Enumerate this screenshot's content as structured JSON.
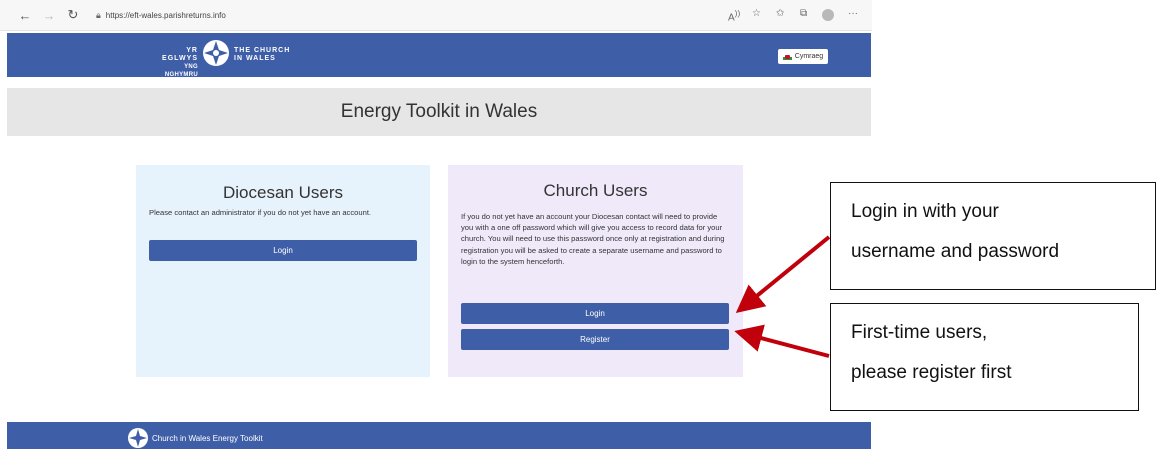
{
  "browser": {
    "url": "https://eft-wales.parishreturns.info",
    "icons": [
      "back-arrow-icon",
      "forward-arrow-icon",
      "refresh-icon",
      "lock-icon",
      "read-aloud-icon",
      "add-favorite-icon",
      "favorites-icon",
      "collections-icon",
      "profile-icon",
      "more-icon"
    ]
  },
  "header": {
    "brand_cy_line1": "YR EGLWYS",
    "brand_cy_line2": "YNG NGHYMRU",
    "brand_en_line1": "THE CHURCH",
    "brand_en_line2": "IN WALES",
    "language_button": "Cymraeg"
  },
  "page": {
    "title": "Energy Toolkit in Wales"
  },
  "diocesan": {
    "heading": "Diocesan Users",
    "text": "Please contact an administrator if you do not yet have an account.",
    "login_label": "Login"
  },
  "church": {
    "heading": "Church Users",
    "text": "If you do not yet have an account your Diocesan contact will need to provide you with a one off password which will give you access to record data for your church. You will need to use this password once only at registration and during registration you will be asked to create a separate username and password to login to the system henceforth.",
    "login_label": "Login",
    "register_label": "Register"
  },
  "footer": {
    "text": "Church in Wales Energy Toolkit"
  },
  "callouts": {
    "login_line1": "Login in with your",
    "login_line2": "username and password",
    "register_line1": "First-time users,",
    "register_line2": "please register first"
  },
  "colors": {
    "brand_blue": "#3f5ea8",
    "arrow_red": "#c0000b",
    "diocesan_bg": "#e7f3fc",
    "church_bg": "#efe9fa"
  }
}
